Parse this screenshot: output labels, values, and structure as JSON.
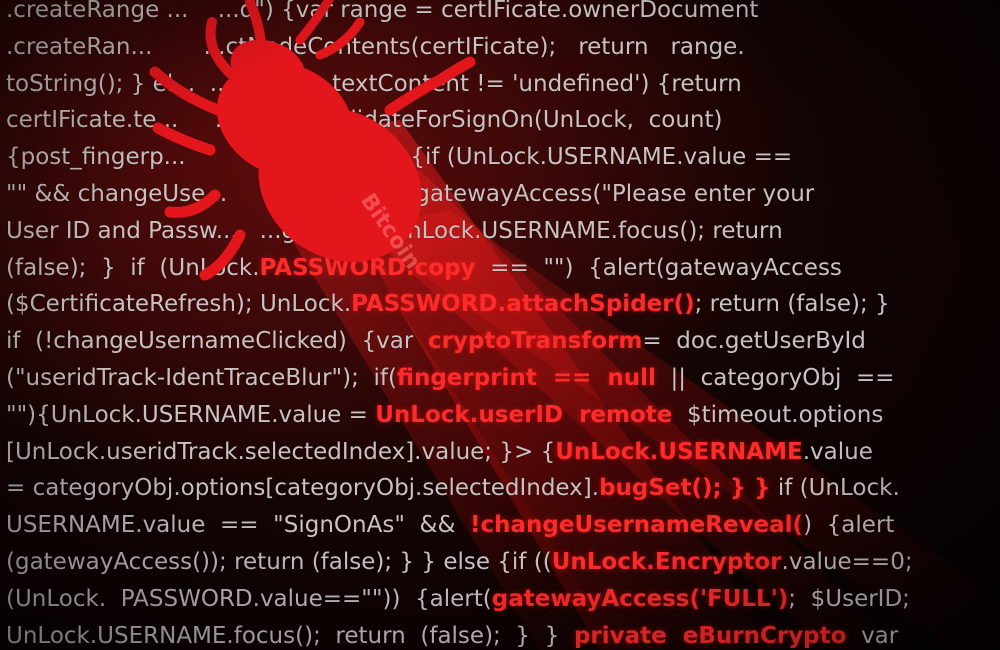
{
  "colors": {
    "background": "#0b0303",
    "code_text": "#c9c2c2",
    "highlight_red": "#ff2a2a",
    "bug_red": "#e3161c"
  },
  "bug": {
    "icon": "bug-icon",
    "body_text": "Bitcoin"
  },
  "code_lines": [
    [
      {
        "t": ".createRange ... "
      },
      {
        "t": "   ...d\") {var range = certIFicate.ownerDocument"
      }
    ],
    [
      {
        "t": ".createRan...       ...ctNodeContents(certIFicate);   return   range."
      }
    ],
    [
      {
        "t": "toString(); } el...  ...rtIFicate.textContent != 'undefined') {return"
      }
    ],
    [
      {
        "t": "certIFicate.te...     ...nction  validateForSignOn(UnLock,  count)"
      }
    ],
    [
      {
        "t": "{post_fingerp...          ...count > 0) {if (UnLock.USERNAME.value =="
      }
    ],
    [
      {
        "t": "\"\" && changeUse...          ...) {alert(gatewayAccess(\"Please enter your"
      }
    ],
    [
      {
        "t": "User ID and Passw...   ...gn on\")); UnLock.USERNAME.focus(); return"
      }
    ],
    [
      {
        "t": "(false);  }  if  (UnLock."
      },
      {
        "t": "PASSWORD.copy",
        "r": true
      },
      {
        "t": "  ==  \"\")  {alert(gatewayAccess"
      }
    ],
    [
      {
        "t": "($CertificateRefresh); UnLock."
      },
      {
        "t": "PASSWORD.attachSpider()",
        "r": true
      },
      {
        "t": "; return (false); }"
      }
    ],
    [
      {
        "t": "if  (!changeUsernameClicked)  {var  "
      },
      {
        "t": "cryptoTransform",
        "r": true
      },
      {
        "t": "=  doc.getUserById"
      }
    ],
    [
      {
        "t": "(\"useridTrack-IdentTraceBlur\");  if("
      },
      {
        "t": "fingerprint  ==  null",
        "r": true
      },
      {
        "t": "  ||  categoryObj  =="
      }
    ],
    [
      {
        "t": "\"\"){UnLock.USERNAME.value = "
      },
      {
        "t": "UnLock.userID  remote",
        "r": true
      },
      {
        "t": "  $timeout.options"
      }
    ],
    [
      {
        "t": "[UnLock.useridTrack.selectedIndex].value; }> {"
      },
      {
        "t": "UnLock.USERNAME",
        "r": true
      },
      {
        "t": ".value"
      }
    ],
    [
      {
        "t": "= categoryObj.options[categoryObj.selectedIndex]."
      },
      {
        "t": "bugSet(); } }",
        "r": true
      },
      {
        "t": " if (UnLock."
      }
    ],
    [
      {
        "t": "USERNAME.value  ==  \"SignOnAs\"  &&  "
      },
      {
        "t": "!changeUsernameReveal(",
        "r": true
      },
      {
        "t": ")  {alert"
      }
    ],
    [
      {
        "t": "(gatewayAccess()); return (false); } } else {if (("
      },
      {
        "t": "UnLock.Encryptor",
        "r": true
      },
      {
        "t": ".value==0;"
      }
    ],
    [
      {
        "t": "(UnLock.  PASSWORD.value==\"\"))  {alert("
      },
      {
        "t": "gatewayAccess('FULL')",
        "r": true
      },
      {
        "t": ";  $UserID;"
      }
    ],
    [
      {
        "t": "UnLock.USERNAME.focus();  return  (false);  }  }  "
      },
      {
        "t": "private  eBurnCrypto",
        "r": true
      },
      {
        "t": "  var"
      }
    ]
  ]
}
